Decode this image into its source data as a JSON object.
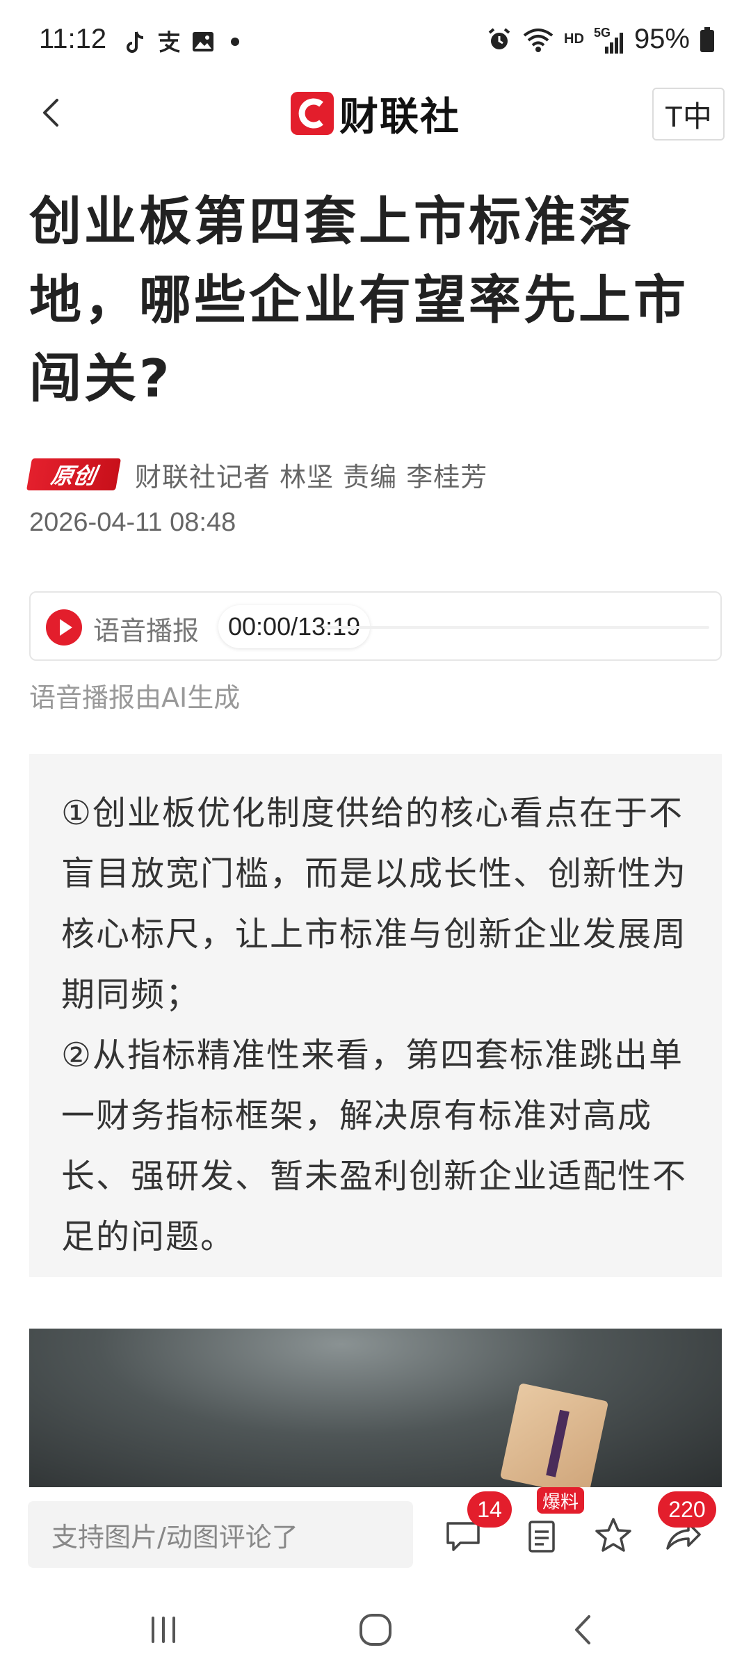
{
  "status_bar": {
    "time": "11:12",
    "network": "HD",
    "signal": "5G",
    "battery": "95%"
  },
  "header": {
    "logo_text": "财联社",
    "font_button": "T中"
  },
  "article": {
    "title": "创业板第四套上市标准落地，哪些企业有望率先上市闯关?",
    "badge": "原创",
    "author": "财联社记者 林坚  责编 李桂芳",
    "date": "2026-04-11 08:48"
  },
  "audio": {
    "label": "语音播报",
    "time": "00:00/13:19",
    "progress": 0,
    "note": "语音播报由AI生成"
  },
  "summary": {
    "point1": "①创业板优化制度供给的核心看点在于不盲目放宽门槛，而是以成长性、创新性为核心标尺，让上市标准与创新企业发展周期同频；",
    "point2": "②从指标精准性来看，第四套标准跳出单一财务指标框架，解决原有标准对高成长、强研发、暂未盈利创新企业适配性不足的问题。"
  },
  "action_bar": {
    "comment_placeholder": "支持图片/动图评论了",
    "comment_count": "14",
    "report_badge": "爆料",
    "share_count": "220"
  },
  "colors": {
    "brand_red": "#e31e2c",
    "summary_bg": "#f5f5f5"
  }
}
